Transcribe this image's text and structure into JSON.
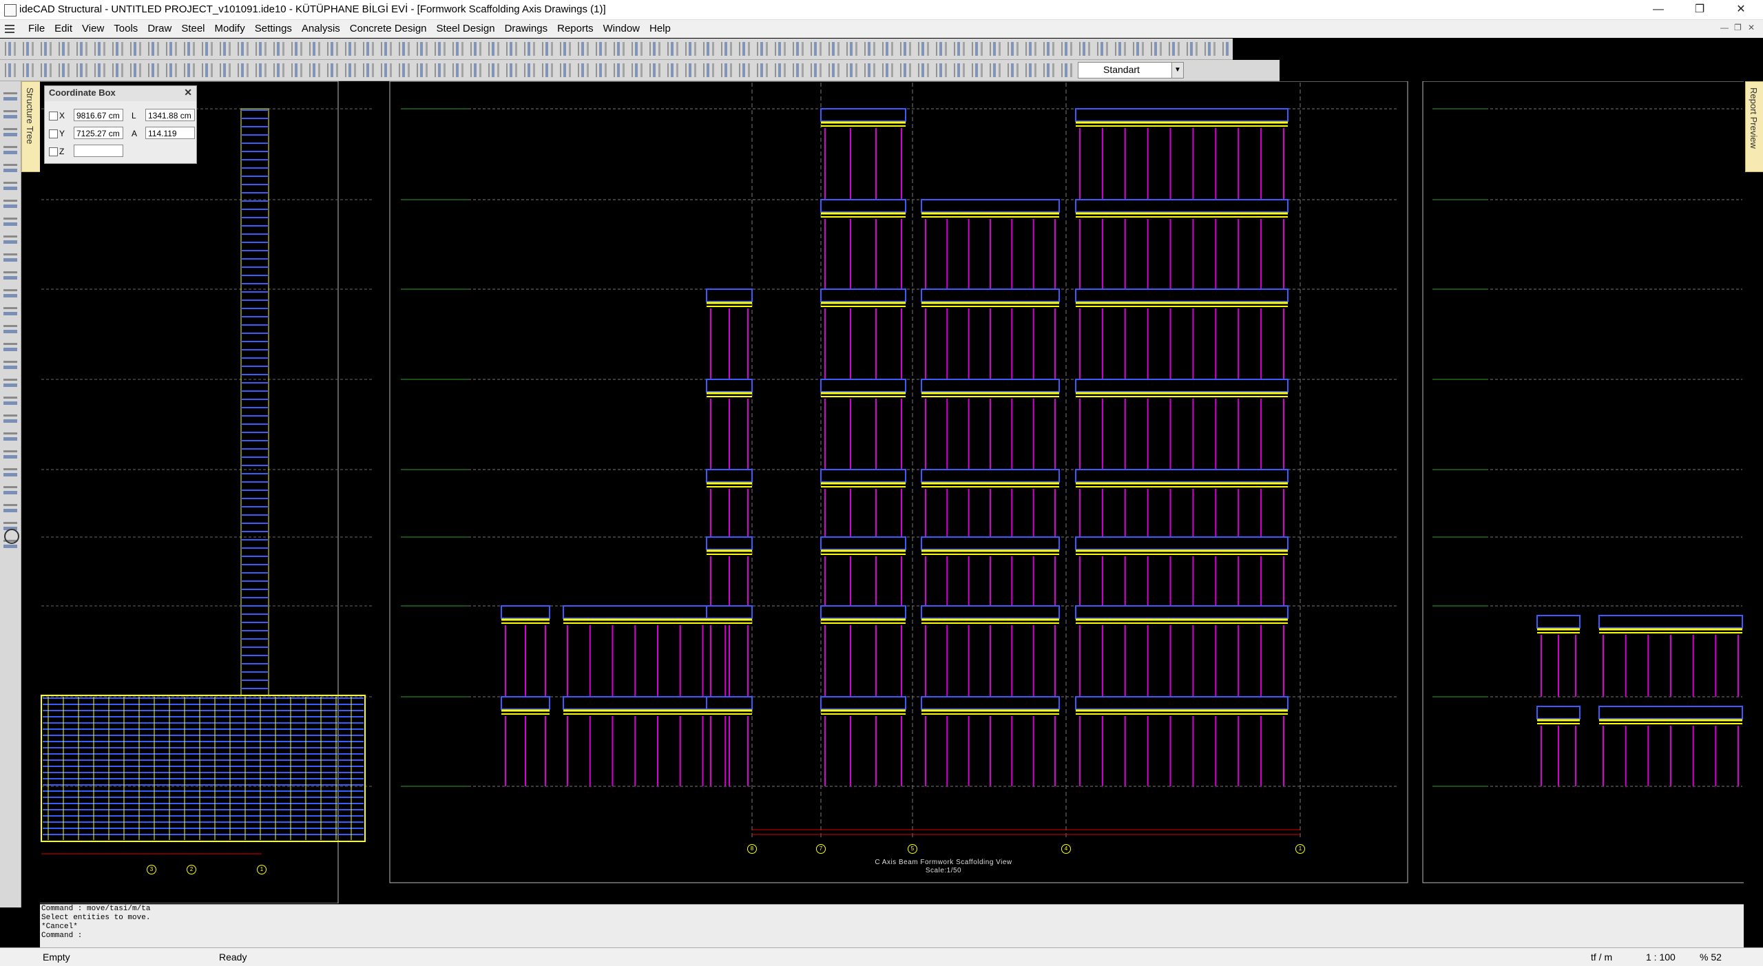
{
  "window": {
    "title": "ideCAD Structural - UNTITLED PROJECT_v101091.ide10 - KÜTÜPHANE BİLGİ EVİ - [Formwork Scaffolding Axis Drawings (1)]",
    "minimize": "—",
    "restore": "❐",
    "close": "✕"
  },
  "menu": {
    "items": [
      "File",
      "Edit",
      "View",
      "Tools",
      "Draw",
      "Steel",
      "Modify",
      "Settings",
      "Analysis",
      "Concrete Design",
      "Steel Design",
      "Drawings",
      "Reports",
      "Window",
      "Help"
    ]
  },
  "toolbar": {
    "style_value": "Standart"
  },
  "side_tabs": {
    "structure_tree": "Structure Tree",
    "report_preview": "Report Preview"
  },
  "coordinate_box": {
    "title": "Coordinate Box",
    "x_label": "X",
    "x_value": "9816.67 cm",
    "y_label": "Y",
    "y_value": "7125.27 cm",
    "z_label": "Z",
    "z_value": "",
    "l_label": "L",
    "l_value": "1341.88 cm",
    "a_label": "A",
    "a_value": "114.119"
  },
  "drawing": {
    "caption_line1": "C Axis Beam Formwork Scaffolding View",
    "caption_line2": "Scale:1/50",
    "axis_labels_main": [
      "8",
      "7",
      "5",
      "4",
      "1"
    ],
    "axis_labels_left": [
      "3",
      "2",
      "1"
    ]
  },
  "command": {
    "lines": [
      "Command : move/tasi/m/ta",
      "Select entities to move.",
      "*Cancel*",
      "Command :"
    ]
  },
  "status": {
    "left": "Empty",
    "mode": "Ready",
    "units": "tf / m",
    "scale": "1 : 100",
    "zoom": "% 52"
  },
  "colors": {
    "canvas": "#000000",
    "scaffold_post": "#d600d6",
    "beam": "#ffff00",
    "formwork": "#3a5cff",
    "level_line": "#2ea02e"
  }
}
